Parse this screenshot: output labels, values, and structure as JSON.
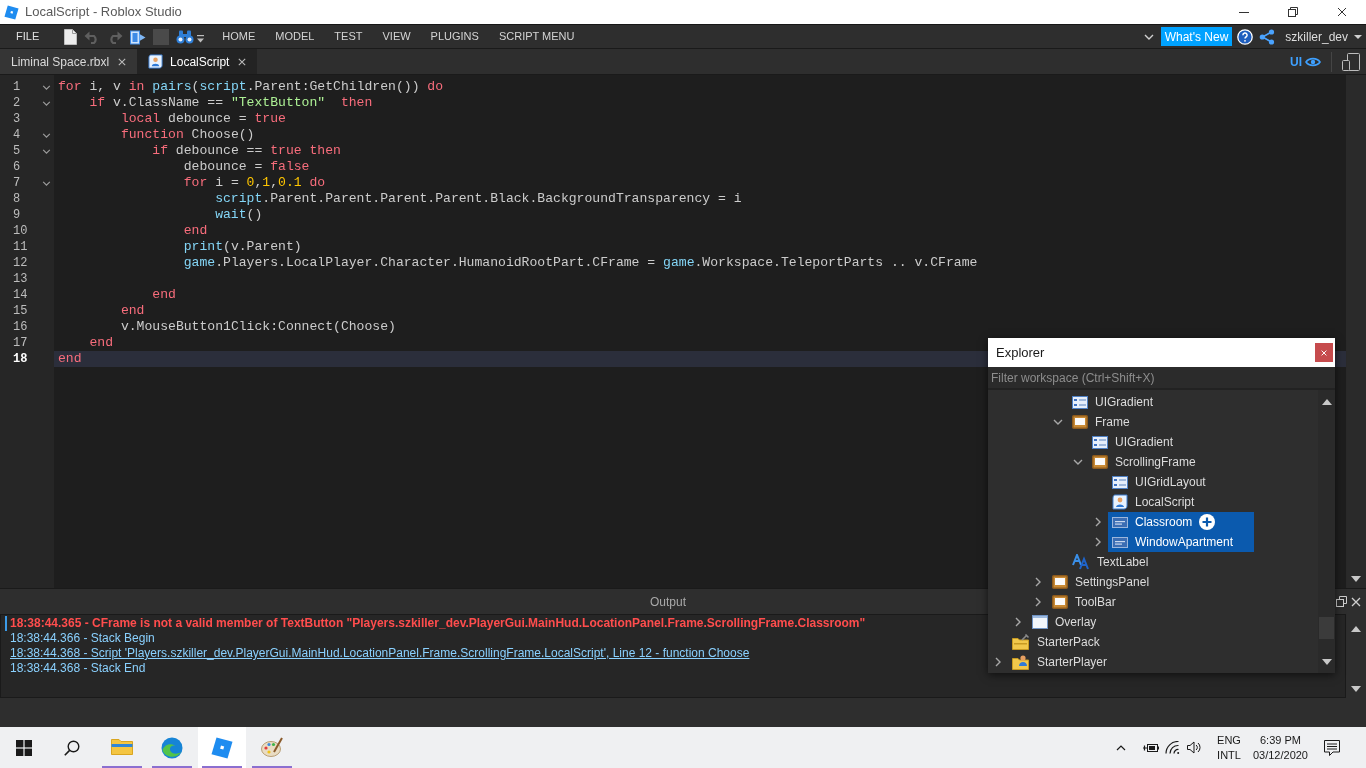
{
  "window": {
    "title": "LocalScript - Roblox Studio"
  },
  "menu_bar": {
    "file_menu": "FILE",
    "tools": [
      {
        "kind": "new-script",
        "disabled": false
      },
      {
        "kind": "undo",
        "disabled": true
      },
      {
        "kind": "redo",
        "disabled": true
      },
      {
        "kind": "plugin",
        "disabled": false
      },
      {
        "kind": "stop",
        "disabled": true
      },
      {
        "kind": "find",
        "disabled": false
      }
    ],
    "tabs": [
      {
        "label": "HOME",
        "selected": false
      },
      {
        "label": "MODEL",
        "selected": false
      },
      {
        "label": "TEST",
        "selected": false
      },
      {
        "label": "VIEW",
        "selected": false
      },
      {
        "label": "PLUGINS",
        "selected": false
      },
      {
        "label": "SCRIPT MENU",
        "selected": false
      }
    ],
    "whats_new": "What's New",
    "user": "szkiller_dev"
  },
  "tab_bar": {
    "tabs": [
      {
        "label": "Liminal Space.rbxl",
        "kind": "place",
        "selected": false
      },
      {
        "label": "LocalScript",
        "kind": "script",
        "selected": true
      }
    ],
    "ui_toggle": {
      "label": "UI",
      "on": true
    }
  },
  "editor": {
    "lines": [
      {
        "number": "1",
        "expanded": true,
        "current": false,
        "tokens": [
          {
            "text": "for",
            "kind": "keyword"
          },
          {
            "text": " i, v ",
            "kind": "plain"
          },
          {
            "text": "in",
            "kind": "keyword"
          },
          {
            "text": " pairs",
            "kind": "builtin"
          },
          {
            "text": "(",
            "kind": "plain"
          },
          {
            "text": "script",
            "kind": "builtin"
          },
          {
            "text": ".Parent:GetChildren()) ",
            "kind": "plain"
          },
          {
            "text": "do",
            "kind": "keyword"
          }
        ]
      },
      {
        "number": "2",
        "expanded": true,
        "current": false,
        "tokens": [
          {
            "text": "    if",
            "kind": "keyword"
          },
          {
            "text": " v.ClassName == ",
            "kind": "plain"
          },
          {
            "text": "\"TextButton\"",
            "kind": "string"
          },
          {
            "text": "  then",
            "kind": "keyword"
          }
        ]
      },
      {
        "number": "3",
        "current": false,
        "tokens": [
          {
            "text": "        local",
            "kind": "keyword"
          },
          {
            "text": " debounce = ",
            "kind": "plain"
          },
          {
            "text": "true",
            "kind": "keyword"
          }
        ]
      },
      {
        "number": "4",
        "expanded": true,
        "current": false,
        "tokens": [
          {
            "text": "        function",
            "kind": "keyword"
          },
          {
            "text": " Choose()",
            "kind": "plain"
          }
        ]
      },
      {
        "number": "5",
        "expanded": true,
        "current": false,
        "tokens": [
          {
            "text": "            if",
            "kind": "keyword"
          },
          {
            "text": " debounce == ",
            "kind": "plain"
          },
          {
            "text": "true",
            "kind": "keyword"
          },
          {
            "text": " then",
            "kind": "keyword"
          }
        ]
      },
      {
        "number": "6",
        "current": false,
        "tokens": [
          {
            "text": "                debounce = ",
            "kind": "plain"
          },
          {
            "text": "false",
            "kind": "keyword"
          }
        ]
      },
      {
        "number": "7",
        "expanded": true,
        "current": false,
        "tokens": [
          {
            "text": "                for",
            "kind": "keyword"
          },
          {
            "text": " i = ",
            "kind": "plain"
          },
          {
            "text": "0",
            "kind": "number"
          },
          {
            "text": ",",
            "kind": "plain"
          },
          {
            "text": "1",
            "kind": "number"
          },
          {
            "text": ",",
            "kind": "plain"
          },
          {
            "text": "0.1",
            "kind": "number"
          },
          {
            "text": " do",
            "kind": "keyword"
          }
        ]
      },
      {
        "number": "8",
        "current": false,
        "tokens": [
          {
            "text": "                    script",
            "kind": "builtin"
          },
          {
            "text": ".Parent.Parent.Parent.Parent.Black.BackgroundTransparency = i",
            "kind": "plain"
          }
        ]
      },
      {
        "number": "9",
        "current": false,
        "tokens": [
          {
            "text": "                    wait",
            "kind": "builtin"
          },
          {
            "text": "()",
            "kind": "plain"
          }
        ]
      },
      {
        "number": "10",
        "current": false,
        "tokens": [
          {
            "text": "                end",
            "kind": "keyword"
          }
        ]
      },
      {
        "number": "11",
        "current": false,
        "tokens": [
          {
            "text": "                print",
            "kind": "builtin"
          },
          {
            "text": "(v.Parent)",
            "kind": "plain"
          }
        ]
      },
      {
        "number": "12",
        "current": false,
        "tokens": [
          {
            "text": "                game",
            "kind": "builtin"
          },
          {
            "text": ".Players.LocalPlayer.Character.HumanoidRootPart.CFrame = ",
            "kind": "plain"
          },
          {
            "text": "game",
            "kind": "builtin"
          },
          {
            "text": ".Workspace.TeleportParts .. v.CFrame",
            "kind": "plain"
          }
        ]
      },
      {
        "number": "13",
        "current": false
      },
      {
        "number": "14",
        "current": false,
        "tokens": [
          {
            "text": "            end",
            "kind": "keyword"
          }
        ]
      },
      {
        "number": "15",
        "current": false,
        "tokens": [
          {
            "text": "        end",
            "kind": "keyword"
          }
        ]
      },
      {
        "number": "16",
        "current": false,
        "tokens": [
          {
            "text": "        v.MouseButton1Click:Connect(Choose)",
            "kind": "plain"
          }
        ]
      },
      {
        "number": "17",
        "current": false,
        "tokens": [
          {
            "text": "    end",
            "kind": "keyword"
          }
        ]
      },
      {
        "number": "18",
        "current": true,
        "tokens": [
          {
            "text": "end",
            "kind": "keyword"
          }
        ]
      }
    ]
  },
  "explorer": {
    "title": "Explorer",
    "filter": {
      "placeholder": "Filter workspace (Ctrl+Shift+X)"
    },
    "tree": [
      {
        "children": [
          {
            "children": [
              {
                "children": [
                  {
                    "label": "UIGradient",
                    "kind": "gradient",
                    "selected": false,
                    "hovered": false
                  },
                  {
                    "label": "Frame",
                    "kind": "frame",
                    "expanded": true,
                    "selected": false,
                    "hovered": false,
                    "children": [
                      {
                        "label": "UIGradient",
                        "kind": "gradient",
                        "selected": false,
                        "hovered": false
                      },
                      {
                        "label": "ScrollingFrame",
                        "kind": "frame",
                        "expanded": true,
                        "selected": false,
                        "hovered": false,
                        "children": [
                          {
                            "label": "UIGridLayout",
                            "kind": "grid-layout",
                            "selected": false,
                            "hovered": false
                          },
                          {
                            "label": "LocalScript",
                            "kind": "local-script",
                            "selected": false,
                            "hovered": false
                          },
                          {
                            "label": "Classroom",
                            "kind": "text-button",
                            "expanded": false,
                            "selected": true,
                            "hovered": true
                          },
                          {
                            "label": "WindowApartment",
                            "kind": "text-button",
                            "expanded": false,
                            "selected": true,
                            "hovered": false
                          }
                        ]
                      }
                    ]
                  },
                  {
                    "label": "TextLabel",
                    "kind": "text-label",
                    "selected": false,
                    "hovered": false
                  }
                ]
              },
              {
                "label": "SettingsPanel",
                "kind": "frame",
                "expanded": false,
                "selected": false,
                "hovered": false
              },
              {
                "label": "ToolBar",
                "kind": "frame",
                "expanded": false,
                "selected": false,
                "hovered": false
              }
            ]
          },
          {
            "label": "Overlay",
            "kind": "screen-gui",
            "expanded": false,
            "selected": false,
            "hovered": false
          }
        ]
      },
      {
        "label": "StarterPack",
        "kind": "starter-pack",
        "selected": false,
        "hovered": false
      },
      {
        "label": "StarterPlayer",
        "kind": "starter-player",
        "expanded": false,
        "selected": false,
        "hovered": false
      }
    ]
  },
  "output": {
    "title": "Output",
    "lines": [
      {
        "text": "18:38:44.365 - CFrame is not a valid member of TextButton \"Players.szkiller_dev.PlayerGui.MainHud.LocationPanel.Frame.ScrollingFrame.Classroom\"",
        "kind": "error",
        "selected": true
      },
      {
        "text": "18:38:44.366 - Stack Begin",
        "kind": "info",
        "selected": false
      },
      {
        "text": "18:38:44.368 - Script 'Players.szkiller_dev.PlayerGui.MainHud.LocationPanel.Frame.ScrollingFrame.LocalScript', Line 12 - function Choose",
        "kind": "link",
        "selected": false
      },
      {
        "text": "18:38:44.368 - Stack End",
        "kind": "info",
        "selected": false
      }
    ]
  },
  "taskbar": {
    "apps": [
      {
        "kind": "folder",
        "running": true,
        "selected": false
      },
      {
        "kind": "browser",
        "running": true,
        "selected": false
      },
      {
        "kind": "studio",
        "running": true,
        "selected": true
      },
      {
        "kind": "paint",
        "running": true,
        "selected": false
      }
    ],
    "language": "ENG",
    "layout": "INTL",
    "time": "6:39 PM",
    "date": "03/12/2020"
  }
}
